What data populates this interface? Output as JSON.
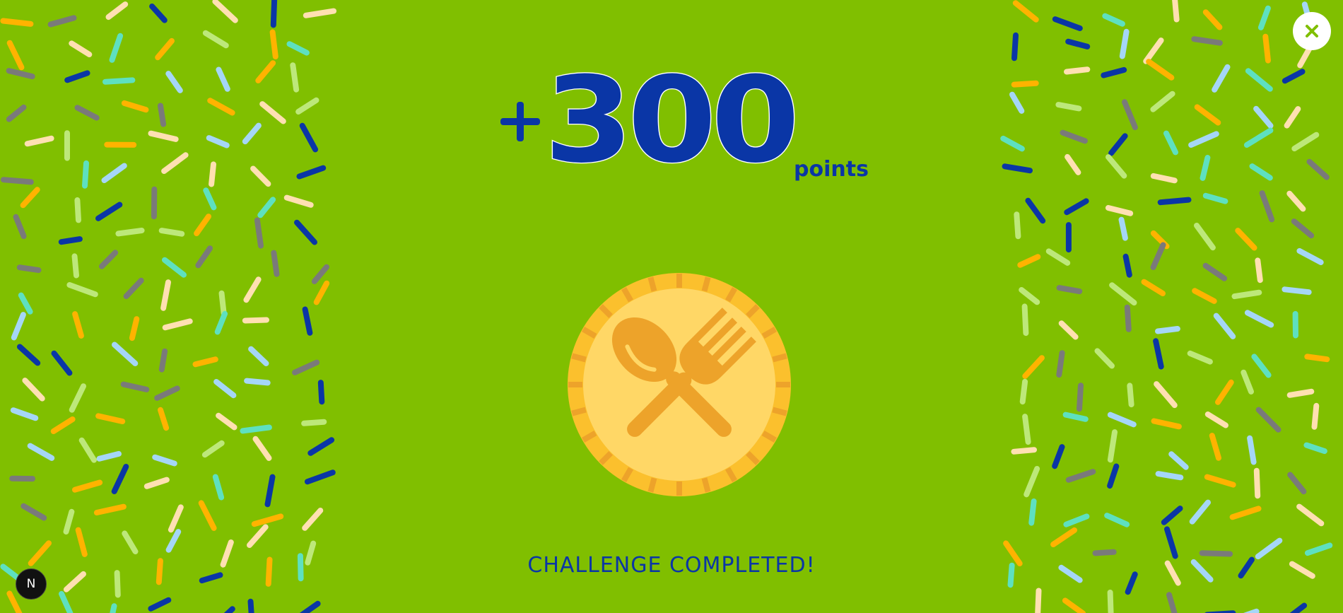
{
  "reward": {
    "prefix_icon": "plus-icon",
    "amount": "300",
    "unit": "points"
  },
  "badge": {
    "icon": "spoon-fork-icon",
    "coin_color": "#fbc02d",
    "inner_color": "#ffd766",
    "glyph_color": "#eda32a"
  },
  "status": {
    "message": "CHALLENGE COMPLETED!"
  },
  "controls": {
    "close_icon": "close-icon",
    "app_badge_label": "N"
  },
  "colors": {
    "background": "#80bf00",
    "accent": "#0a36a6",
    "confetti": [
      "#ffb300",
      "#0a36a6",
      "#a5d6f7",
      "#5ee0c0",
      "#bde87a",
      "#7a7a7a",
      "#ffe0b2"
    ]
  }
}
